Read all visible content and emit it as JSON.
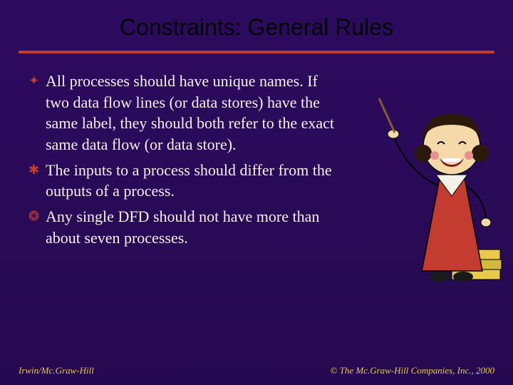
{
  "title": "Constraints: General Rules",
  "bullets": [
    {
      "icon": "✦",
      "text": "All processes should have unique names.  If two data flow lines (or data stores) have the same label, they should both refer to the exact same data flow (or data store)."
    },
    {
      "icon": "✱",
      "text": "The inputs to a process should differ from the outputs of a process."
    },
    {
      "icon": "❂",
      "text": "Any single DFD should not have more than about seven processes."
    }
  ],
  "footer": {
    "left": "Irwin/Mc.Graw-Hill",
    "right": "© The Mc.Graw-Hill Companies, Inc., 2000"
  },
  "illustration": {
    "desc": "cartoon-teacher-with-pointer-and-books"
  }
}
